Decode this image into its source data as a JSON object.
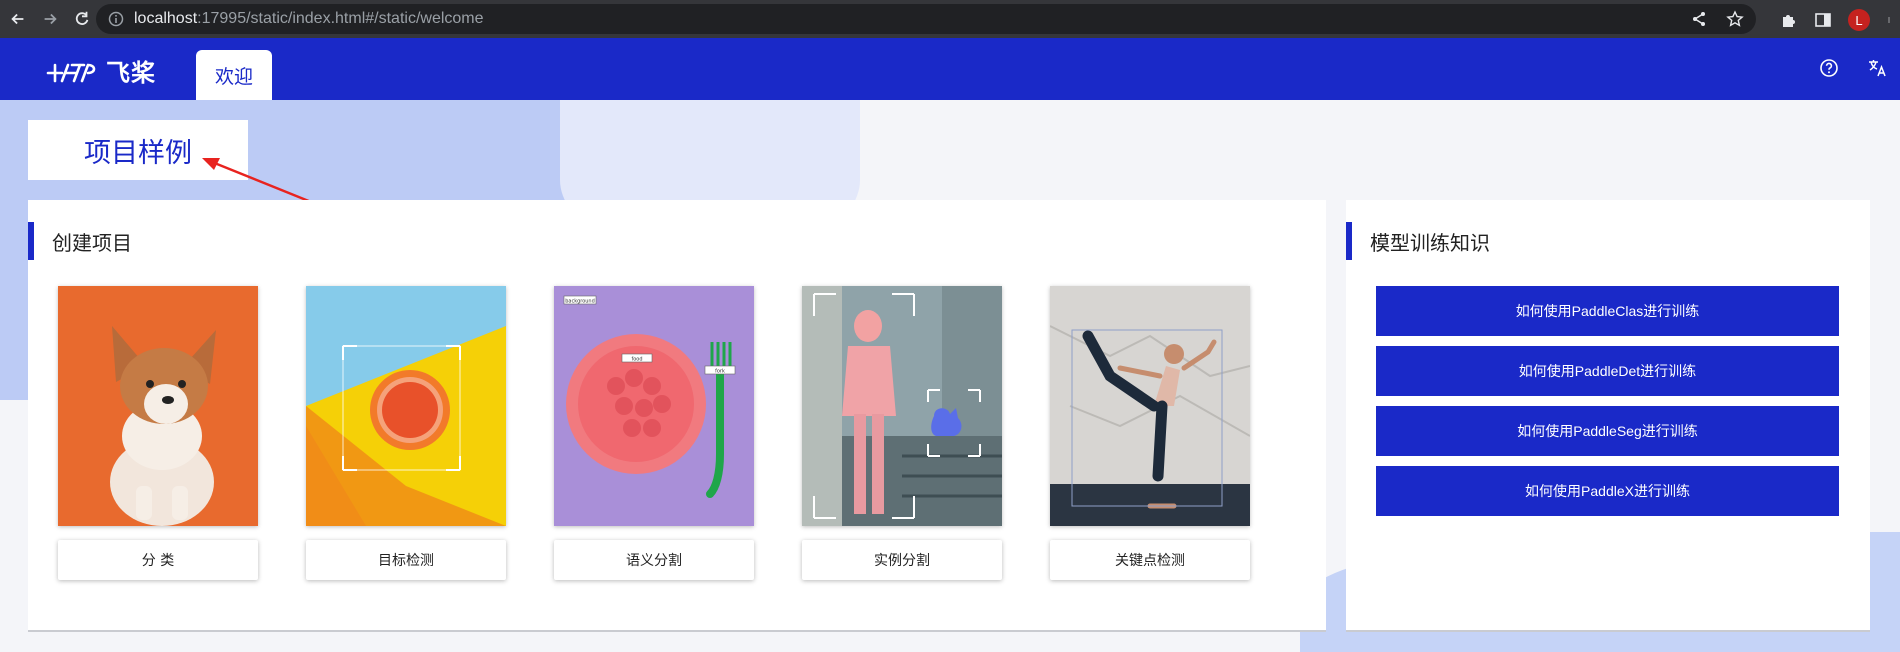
{
  "browser": {
    "url_host": "localhost",
    "url_rest": ":17995/static/index.html#/static/welcome",
    "profile_initial": "L"
  },
  "appbar": {
    "logo_text": "飞桨",
    "tab_label": "欢迎",
    "accent": "#1a29c8"
  },
  "page": {
    "title": "项目样例"
  },
  "create_panel": {
    "title": "创建项目",
    "cards": [
      {
        "label": "分 类",
        "image": "corgi-dog-photo"
      },
      {
        "label": "目标检测",
        "image": "orange-detection-photo"
      },
      {
        "label": "语义分割",
        "image": "plate-segmentation-photo"
      },
      {
        "label": "实例分割",
        "image": "woman-dog-instance-photo"
      },
      {
        "label": "关键点检测",
        "image": "yoga-keypoint-photo"
      }
    ]
  },
  "knowledge_panel": {
    "title": "模型训练知识",
    "links": [
      "如何使用PaddleClas进行训练",
      "如何使用PaddleDet进行训练",
      "如何使用PaddleSeg进行训练",
      "如何使用PaddleX进行训练"
    ]
  },
  "image_labels": {
    "seg_background": "background",
    "seg_food": "food",
    "seg_fork": "fork"
  }
}
